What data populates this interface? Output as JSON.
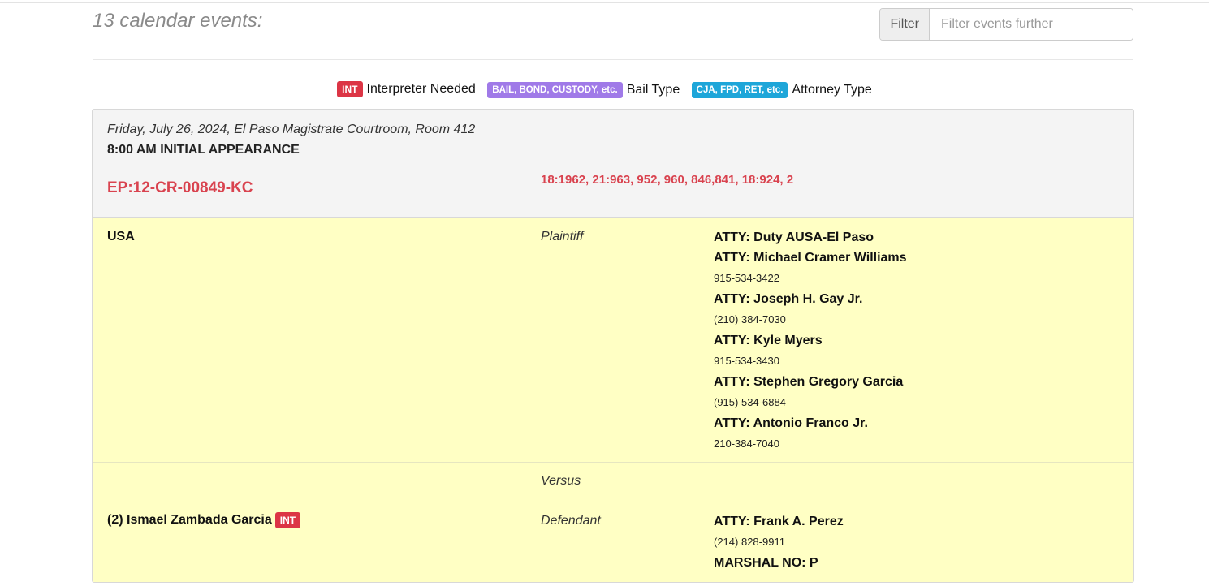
{
  "header": {
    "count_text": "13 calendar events:",
    "filter_label": "Filter",
    "filter_placeholder": "Filter events further"
  },
  "legend": [
    {
      "badge": "INT",
      "label": "Interpreter Needed",
      "color": "#dc3545"
    },
    {
      "badge": "BAIL, BOND, CUSTODY, etc.",
      "label": "Bail Type",
      "color": "#a07ae8"
    },
    {
      "badge": "CJA, FPD, RET, etc.",
      "label": "Attorney Type",
      "color": "#1ea6d9"
    }
  ],
  "event": {
    "date_location": "Friday, July 26, 2024, El Paso Magistrate Courtroom, Room 412",
    "time_type": "8:00 AM INITIAL APPEARANCE",
    "case_number": "EP:12-CR-00849-KC",
    "statutes": "18:1962, 21:963, 952, 960, 846,841, 18:924, 2",
    "plaintiff": {
      "name": "USA",
      "role": "Plaintiff",
      "attorneys": [
        {
          "name": "ATTY: Duty AUSA-El Paso",
          "phone": ""
        },
        {
          "name": "ATTY: Michael Cramer Williams",
          "phone": "915-534-3422"
        },
        {
          "name": "ATTY: Joseph H. Gay Jr.",
          "phone": "(210) 384-7030"
        },
        {
          "name": "ATTY: Kyle Myers",
          "phone": "915-534-3430"
        },
        {
          "name": "ATTY: Stephen Gregory Garcia",
          "phone": "(915) 534-6884"
        },
        {
          "name": "ATTY: Antonio Franco Jr.",
          "phone": "210-384-7040"
        }
      ]
    },
    "versus_label": "Versus",
    "defendant": {
      "name": "(2) Ismael Zambada Garcia",
      "badge": "INT",
      "role": "Defendant",
      "attorney_name": "ATTY: Frank A. Perez",
      "attorney_phone": "(214) 828-9911",
      "marshal": "MARSHAL NO: P"
    }
  },
  "colors": {
    "case_red": "#d9434f",
    "party_bg": "#ffffc4",
    "header_bg": "#f4f4f4"
  }
}
